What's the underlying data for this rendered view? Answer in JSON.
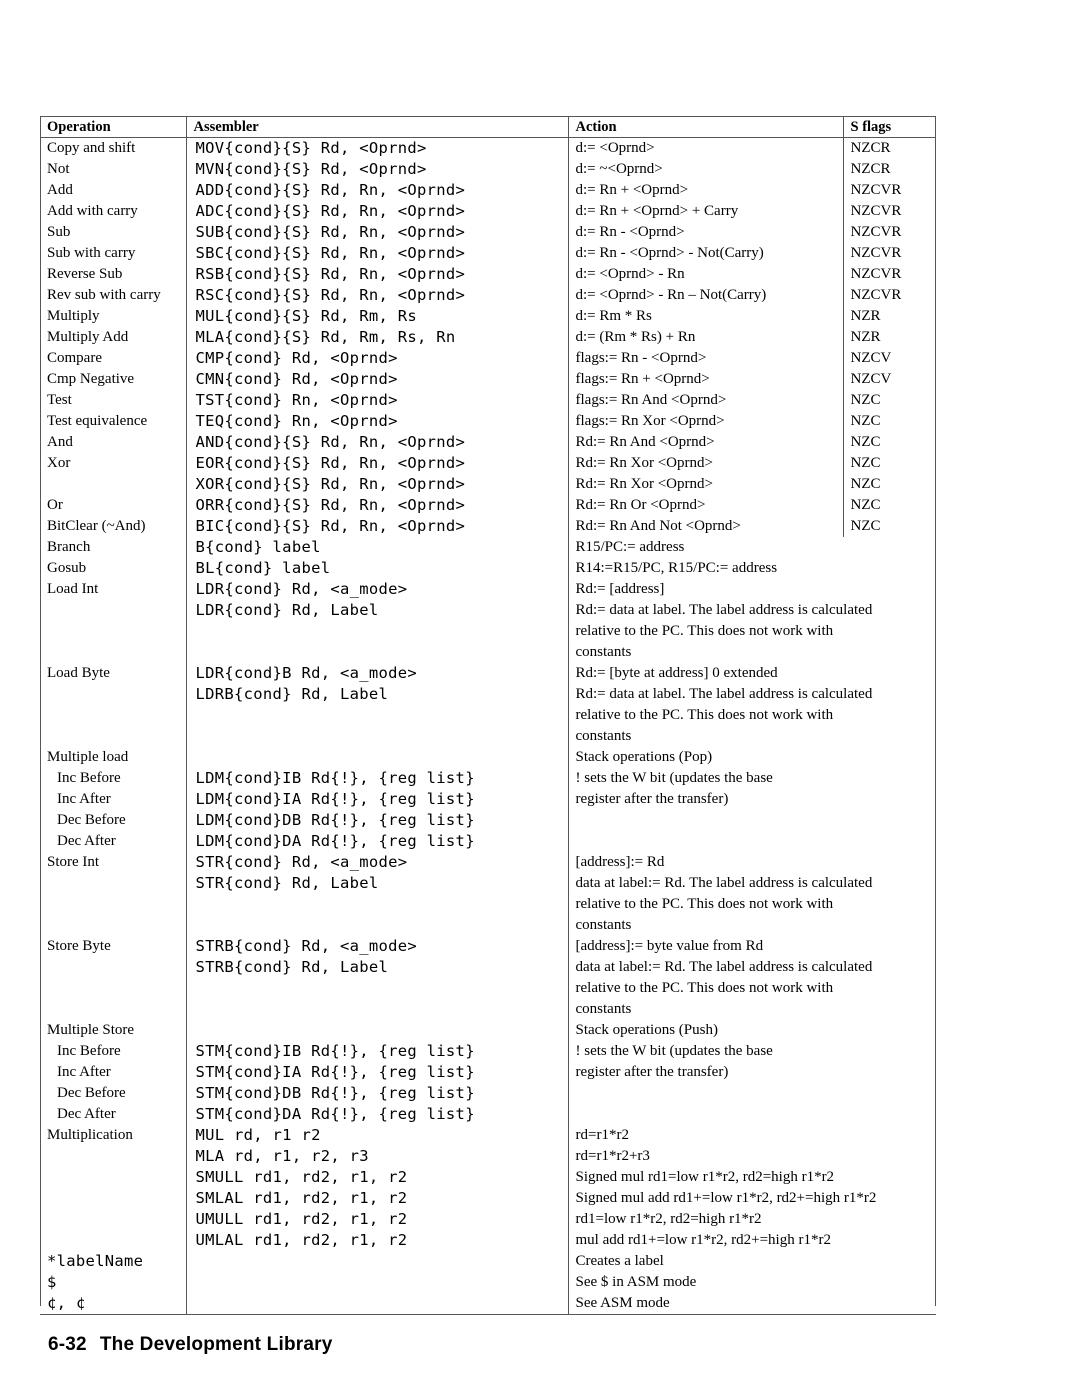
{
  "document": {
    "footer": {
      "page_number": "6-32",
      "title": "The Development Library"
    }
  },
  "table": {
    "headers": [
      "Operation",
      "Assembler",
      "Action",
      "S flags"
    ],
    "rows": [
      {
        "operation": "Copy and shift",
        "assembler": "MOV{cond}{S} Rd, <Oprnd>",
        "action": "d:= <Oprnd>",
        "flags": "NZCR"
      },
      {
        "operation": "Not",
        "assembler": "MVN{cond}{S} Rd, <Oprnd>",
        "action": "d:= ~<Oprnd>",
        "flags": "NZCR"
      },
      {
        "operation": "Add",
        "assembler": "ADD{cond}{S} Rd, Rn, <Oprnd>",
        "action": "d:= Rn + <Oprnd>",
        "flags": "NZCVR"
      },
      {
        "operation": "Add with carry",
        "assembler": "ADC{cond}{S} Rd, Rn, <Oprnd>",
        "action": "d:= Rn + <Oprnd> + Carry",
        "flags": "NZCVR"
      },
      {
        "operation": "Sub",
        "assembler": "SUB{cond}{S} Rd, Rn, <Oprnd>",
        "action": "d:= Rn - <Oprnd>",
        "flags": "NZCVR"
      },
      {
        "operation": "Sub with carry",
        "assembler": "SBC{cond}{S} Rd, Rn, <Oprnd>",
        "action": "d:= Rn - <Oprnd> - Not(Carry)",
        "flags": "NZCVR"
      },
      {
        "operation": "Reverse Sub",
        "assembler": "RSB{cond}{S} Rd, Rn, <Oprnd>",
        "action": "d:= <Oprnd> - Rn",
        "flags": "NZCVR"
      },
      {
        "operation": "Rev sub with carry",
        "assembler": "RSC{cond}{S} Rd, Rn, <Oprnd>",
        "action": "d:= <Oprnd> - Rn – Not(Carry)",
        "flags": "NZCVR"
      },
      {
        "operation": "Multiply",
        "assembler": "MUL{cond}{S} Rd, Rm, Rs",
        "action": "d:= Rm * Rs",
        "flags": "NZR"
      },
      {
        "operation": "Multiply Add",
        "assembler": "MLA{cond}{S} Rd, Rm, Rs, Rn",
        "action": "d:= (Rm * Rs) + Rn",
        "flags": "NZR"
      },
      {
        "operation": "Compare",
        "assembler": "CMP{cond} Rd, <Oprnd>",
        "action": "flags:= Rn - <Oprnd>",
        "flags": "NZCV"
      },
      {
        "operation": "Cmp Negative",
        "assembler": "CMN{cond} Rd, <Oprnd>",
        "action": "flags:= Rn + <Oprnd>",
        "flags": "NZCV"
      },
      {
        "operation": "Test",
        "assembler": "TST{cond} Rn, <Oprnd>",
        "action": "flags:= Rn And <Oprnd>",
        "flags": "NZC"
      },
      {
        "operation": "Test equivalence",
        "assembler": "TEQ{cond} Rn, <Oprnd>",
        "action": "flags:= Rn Xor <Oprnd>",
        "flags": "NZC"
      },
      {
        "operation": "And",
        "assembler": "AND{cond}{S} Rd, Rn, <Oprnd>",
        "action": "Rd:= Rn And <Oprnd>",
        "flags": "NZC"
      },
      {
        "operation": "Xor",
        "assembler": "EOR{cond}{S} Rd, Rn, <Oprnd>",
        "action": "Rd:= Rn Xor <Oprnd>",
        "flags": "NZC"
      },
      {
        "operation": "",
        "assembler": "XOR{cond}{S} Rd, Rn, <Oprnd>",
        "action": "Rd:= Rn Xor <Oprnd>",
        "flags": "NZC"
      },
      {
        "operation": "Or",
        "assembler": "ORR{cond}{S} Rd, Rn, <Oprnd>",
        "action": "Rd:= Rn Or <Oprnd>",
        "flags": "NZC"
      },
      {
        "operation": "BitClear (~And)",
        "assembler": "BIC{cond}{S} Rd, Rn, <Oprnd>",
        "action": "Rd:= Rn And Not <Oprnd>",
        "flags": "NZC"
      },
      {
        "operation": "Branch",
        "assembler": "B{cond} label",
        "action": "R15/PC:= address",
        "flags": ""
      },
      {
        "operation": "Gosub",
        "assembler": "BL{cond} label",
        "action": "R14:=R15/PC, R15/PC:= address",
        "flags": ""
      },
      {
        "operation": "Load Int",
        "assembler": "LDR{cond} Rd, <a_mode>",
        "action": "Rd:= [address]",
        "flags": ""
      },
      {
        "operation": "",
        "assembler": "LDR{cond} Rd, Label",
        "action": "Rd:= data at label. The label address is calculated",
        "flags": ""
      },
      {
        "operation": "",
        "assembler": "",
        "action": "relative to the PC. This does not work with",
        "flags": ""
      },
      {
        "operation": "",
        "assembler": "",
        "action": "constants",
        "flags": ""
      },
      {
        "operation": "Load Byte",
        "assembler": "LDR{cond}B Rd, <a_mode>",
        "action": "Rd:= [byte at address] 0 extended",
        "flags": ""
      },
      {
        "operation": "",
        "assembler": "LDRB{cond} Rd, Label",
        "action": "Rd:= data at label. The label address is calculated",
        "flags": ""
      },
      {
        "operation": "",
        "assembler": "",
        "action": "relative to the PC. This does not work with",
        "flags": ""
      },
      {
        "operation": "",
        "assembler": "",
        "action": "constants",
        "flags": ""
      },
      {
        "operation": "Multiple load",
        "assembler": "",
        "action": "Stack operations (Pop)",
        "flags": ""
      },
      {
        "operation": "Inc Before",
        "assembler": "LDM{cond}IB Rd{!}, {reg list}",
        "action": "! sets the W bit (updates the base",
        "flags": "",
        "indent": true
      },
      {
        "operation": "Inc After",
        "assembler": "LDM{cond}IA Rd{!}, {reg list}",
        "action": "register after the transfer)",
        "flags": "",
        "indent": true
      },
      {
        "operation": "Dec Before",
        "assembler": "LDM{cond}DB Rd{!}, {reg list}",
        "action": "",
        "flags": "",
        "indent": true
      },
      {
        "operation": "Dec After",
        "assembler": "LDM{cond}DA Rd{!}, {reg list}",
        "action": "",
        "flags": "",
        "indent": true
      },
      {
        "operation": "Store Int",
        "assembler": "STR{cond} Rd, <a_mode>",
        "action": "[address]:= Rd",
        "flags": ""
      },
      {
        "operation": "",
        "assembler": "STR{cond} Rd, Label",
        "action": "data at label:= Rd. The label address is calculated",
        "flags": ""
      },
      {
        "operation": "",
        "assembler": "",
        "action": "relative to the PC. This does not work with",
        "flags": ""
      },
      {
        "operation": "",
        "assembler": "",
        "action": "constants",
        "flags": ""
      },
      {
        "operation": "Store Byte",
        "assembler": "STRB{cond} Rd, <a_mode>",
        "action": "[address]:= byte value from Rd",
        "flags": ""
      },
      {
        "operation": "",
        "assembler": "STRB{cond} Rd, Label",
        "action": "data at label:= Rd. The label address is calculated",
        "flags": ""
      },
      {
        "operation": "",
        "assembler": "",
        "action": "relative to the PC. This does not work with",
        "flags": ""
      },
      {
        "operation": "",
        "assembler": "",
        "action": "constants",
        "flags": ""
      },
      {
        "operation": "Multiple Store",
        "assembler": "",
        "action": "Stack operations (Push)",
        "flags": ""
      },
      {
        "operation": "Inc Before",
        "assembler": "STM{cond}IB Rd{!}, {reg list}",
        "action": "! sets the W bit (updates the base",
        "flags": "",
        "indent": true
      },
      {
        "operation": "Inc After",
        "assembler": "STM{cond}IA Rd{!}, {reg list}",
        "action": "register after the transfer)",
        "flags": "",
        "indent": true
      },
      {
        "operation": "Dec Before",
        "assembler": "STM{cond}DB Rd{!}, {reg list}",
        "action": "",
        "flags": "",
        "indent": true
      },
      {
        "operation": "Dec After",
        "assembler": "STM{cond}DA Rd{!}, {reg list}",
        "action": "",
        "flags": "",
        "indent": true
      },
      {
        "operation": "Multiplication",
        "assembler": "MUL rd, r1 r2",
        "action": "rd=r1*r2",
        "flags": ""
      },
      {
        "operation": "",
        "assembler": "MLA rd, r1, r2, r3",
        "action": "rd=r1*r2+r3",
        "flags": ""
      },
      {
        "operation": "",
        "assembler": "SMULL rd1, rd2, r1, r2",
        "action": "Signed mul rd1=low r1*r2, rd2=high r1*r2",
        "flags": ""
      },
      {
        "operation": "",
        "assembler": "SMLAL rd1, rd2, r1, r2",
        "action": "Signed mul add rd1+=low r1*r2, rd2+=high r1*r2",
        "flags": ""
      },
      {
        "operation": "",
        "assembler": "UMULL rd1, rd2, r1, r2",
        "action": "rd1=low r1*r2, rd2=high r1*r2",
        "flags": ""
      },
      {
        "operation": "",
        "assembler": "UMLAL rd1, rd2, r1, r2",
        "action": "mul add rd1+=low r1*r2, rd2+=high r1*r2",
        "flags": ""
      },
      {
        "operation": "*labelName",
        "assembler": "",
        "action": "Creates a label",
        "flags": "",
        "op_mono": true
      },
      {
        "operation": "$",
        "assembler": "",
        "action": "See $ in ASM mode",
        "flags": "",
        "op_mono": true
      },
      {
        "operation": "¢, ¢",
        "assembler": "",
        "action": "See ASM mode",
        "flags": "",
        "op_mono": true
      }
    ]
  }
}
